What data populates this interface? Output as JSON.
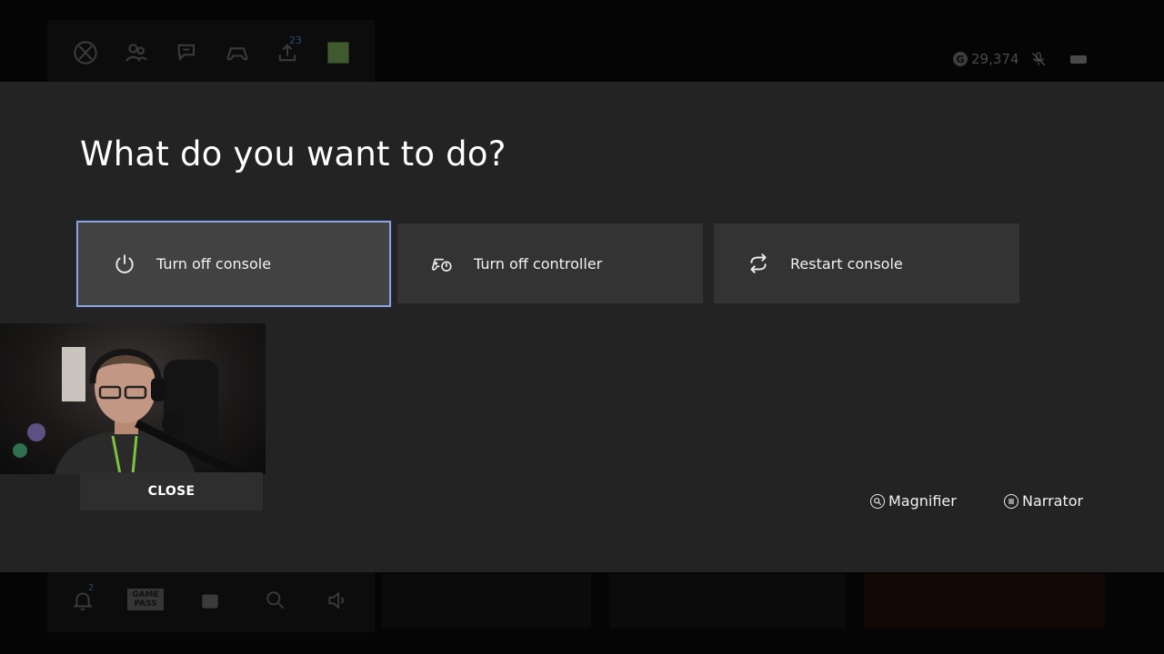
{
  "guide": {
    "upload_badge": "23",
    "gamerscore": "29,374",
    "g_symbol": "G",
    "notification_badge": "2",
    "gamepass_label": "GAME PASS"
  },
  "dialog": {
    "title": "What do you want to do?",
    "options": [
      {
        "label": "Turn off console",
        "icon": "power-icon",
        "focused": true
      },
      {
        "label": "Turn off controller",
        "icon": "controller-power-icon",
        "focused": false
      },
      {
        "label": "Restart console",
        "icon": "restart-icon",
        "focused": false
      }
    ],
    "accessibility": [
      {
        "label": "Magnifier",
        "icon": "magnifier-icon"
      },
      {
        "label": "Narrator",
        "icon": "narrator-icon"
      }
    ],
    "focus_color": "#8fa3d6"
  },
  "webcam": {
    "close_label": "CLOSE"
  }
}
